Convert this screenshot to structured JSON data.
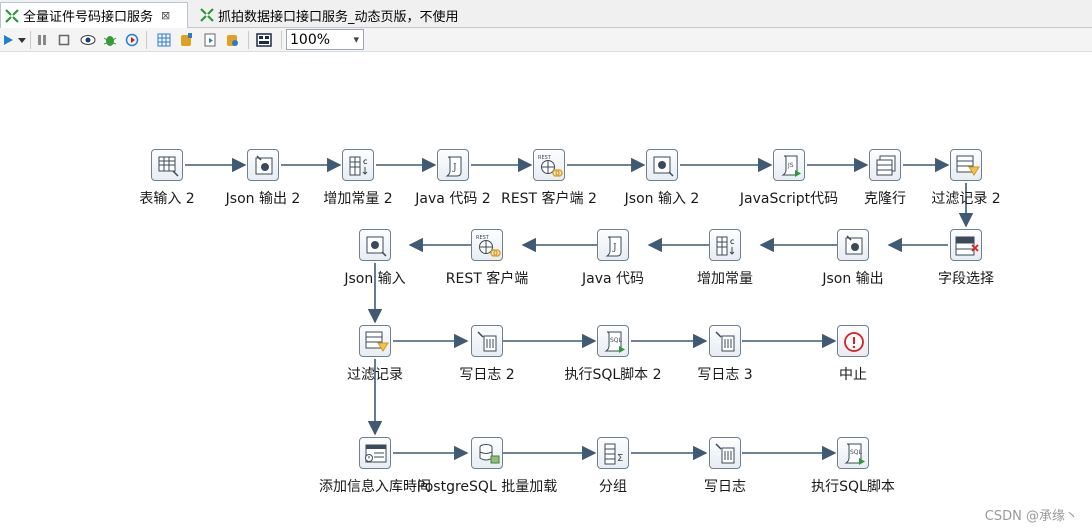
{
  "tabs": [
    {
      "label": "全量证件号码接口服务",
      "close": "⊠",
      "active": true
    },
    {
      "label": "抓拍数据接口接口服务_动态页版，不使用",
      "active": false
    }
  ],
  "toolbar": {
    "zoom": "100%",
    "icons": [
      "run-icon",
      "dropdown-icon",
      "pause-icon",
      "stop-icon",
      "preview-icon",
      "debug-icon",
      "replay-icon",
      "verify-icon",
      "impact-icon",
      "sql-icon",
      "explore-icon",
      "db-cache-icon",
      "layout-icon"
    ]
  },
  "steps": {
    "s1": {
      "label": "表输入 2",
      "icon": "table-input-icon"
    },
    "s2": {
      "label": "Json 输出 2",
      "icon": "json-output-icon"
    },
    "s3": {
      "label": "增加常量 2",
      "icon": "add-constant-icon"
    },
    "s4": {
      "label": "Java 代码 2",
      "icon": "java-code-icon"
    },
    "s5": {
      "label": "REST 客户端 2",
      "icon": "rest-client-icon"
    },
    "s6": {
      "label": "Json 输入 2",
      "icon": "json-input-icon"
    },
    "s7": {
      "label": "JavaScript代码",
      "icon": "javascript-icon"
    },
    "s8": {
      "label": "克隆行",
      "icon": "clone-row-icon"
    },
    "s9": {
      "label": "过滤记录 2",
      "icon": "filter-rows-icon"
    },
    "r1": {
      "label": "Json 输入",
      "icon": "json-input-icon"
    },
    "r2": {
      "label": "REST 客户端",
      "icon": "rest-client-icon"
    },
    "r3": {
      "label": "Java 代码",
      "icon": "java-code-icon"
    },
    "r4": {
      "label": "增加常量",
      "icon": "add-constant-icon"
    },
    "r5": {
      "label": "Json 输出",
      "icon": "json-output-icon"
    },
    "r6": {
      "label": "字段选择",
      "icon": "select-values-icon"
    },
    "t1": {
      "label": "过滤记录",
      "icon": "filter-rows-icon"
    },
    "t2": {
      "label": "写日志 2",
      "icon": "write-log-icon"
    },
    "t3": {
      "label": "执行SQL脚本 2",
      "icon": "sql-script-icon"
    },
    "t4": {
      "label": "写日志 3",
      "icon": "write-log-icon"
    },
    "t5": {
      "label": "中止",
      "icon": "abort-icon"
    },
    "u1": {
      "label": "添加信息入库時间",
      "icon": "add-info-icon"
    },
    "u2": {
      "label": "PostgreSQL 批量加载",
      "icon": "pg-bulk-load-icon"
    },
    "u3": {
      "label": "分组",
      "icon": "group-by-icon"
    },
    "u4": {
      "label": "写日志",
      "icon": "write-log-icon"
    },
    "u5": {
      "label": "执行SQL脚本",
      "icon": "sql-script-icon"
    }
  },
  "watermark": "CSDN @承缘丶",
  "colors": {
    "hop": "#3f5a72",
    "accent_green": "#2a9a3a",
    "abort_red": "#d62020"
  }
}
